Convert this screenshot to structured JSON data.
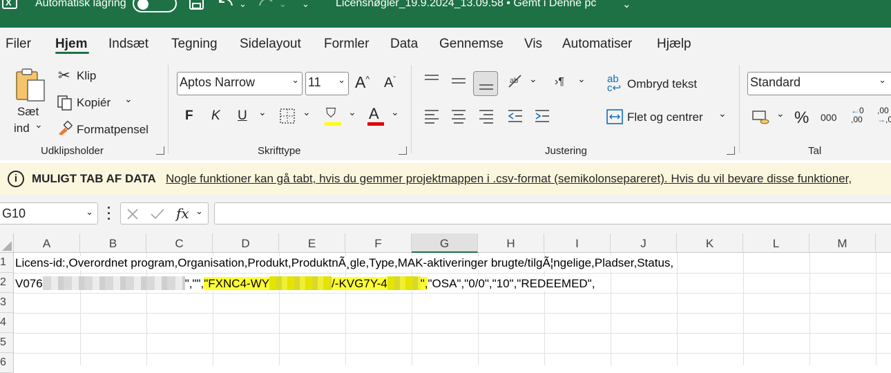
{
  "titlebar": {
    "autosave_label": "Automatisk lagring",
    "doc_title": "Licensnøgler_19.9.2024_13.09.58 • Gemt i Denne pc"
  },
  "menu": {
    "items": [
      "Filer",
      "Hjem",
      "Indsæt",
      "Tegning",
      "Sidelayout",
      "Formler",
      "Data",
      "Gennemse",
      "Vis",
      "Automatiser",
      "Hjælp"
    ],
    "active": "Hjem"
  },
  "ribbon": {
    "clipboard": {
      "paste_line1": "Sæt",
      "paste_line2": "ind",
      "cut": "Klip",
      "copy": "Kopiér",
      "format_painter": "Formatpensel",
      "group": "Udklipsholder"
    },
    "font": {
      "font_name": "Aptos Narrow",
      "font_size": "11",
      "bold": "F",
      "italic": "K",
      "underline": "U",
      "group": "Skrifttype"
    },
    "alignment": {
      "wrap_text": "Ombryd tekst",
      "merge_center": "Flet og centrer",
      "group": "Justering"
    },
    "number": {
      "format": "Standard",
      "percent": "%",
      "thousands": "000",
      "group": "Tal"
    }
  },
  "infobar": {
    "heading": "MULIGT TAB AF DATA",
    "message": "Nogle funktioner kan gå tabt, hvis du gemmer projektmappen i .csv-format (semikolonsepareret). Hvis du vil bevare disse funktioner,"
  },
  "formulabar": {
    "name_box": "G10",
    "fx": "fx",
    "formula": ""
  },
  "sheet": {
    "columns": [
      "A",
      "B",
      "C",
      "D",
      "E",
      "F",
      "G",
      "H",
      "I",
      "J",
      "K",
      "L",
      "M"
    ],
    "rows": [
      "1",
      "2",
      "3",
      "4",
      "5",
      "6"
    ],
    "row1": "Licens-id:,Overordnet program,Organisation,Produkt,ProduktnÃ¸gle,Type,MAK-aktiveringer brugte/tilgÃ¦ngelige,Pladser,Status,",
    "row2_prefix": "V076",
    "row2_mid": "\",\"\",",
    "row2_key_a": "\"FXNC4-WY",
    "row2_key_b": "/-KVG7Y-4",
    "row2_key_c": "\",",
    "row2_suffix": "\"OSA\",\"0/0\",\"10\",\"REDEEMED\","
  },
  "colors": {
    "title_green": "#1e7145",
    "highlight": "#ffff33",
    "infobar_bg": "#fbf6de"
  }
}
